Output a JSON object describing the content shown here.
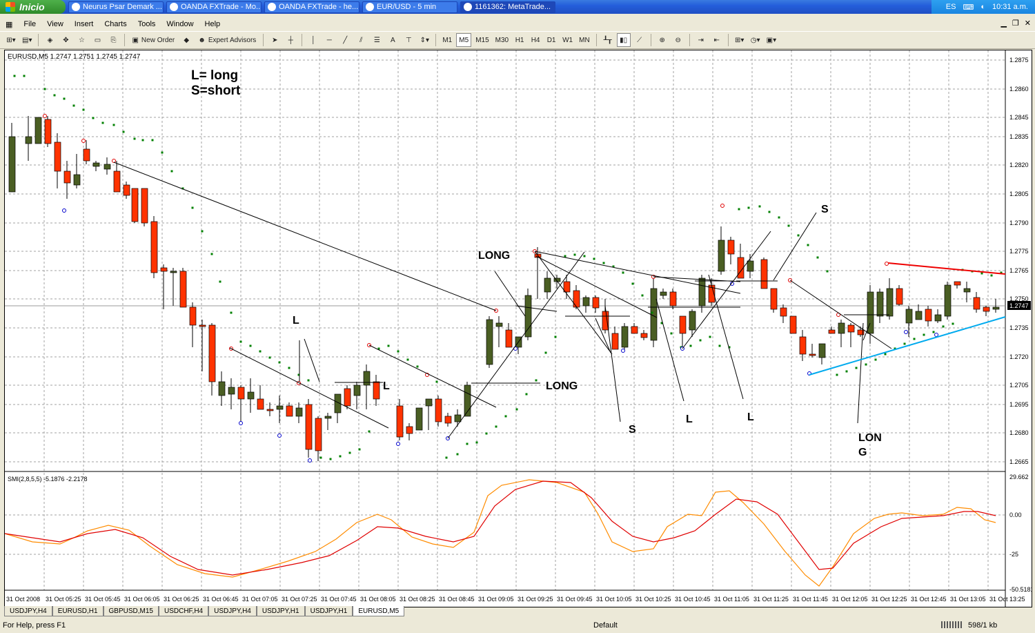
{
  "taskbar": {
    "start_label": "Inicio",
    "tasks": [
      {
        "label": "Neurus Psar Demark ..."
      },
      {
        "label": "OANDA FXTrade - Mo..."
      },
      {
        "label": "OANDA FXTrade - he..."
      },
      {
        "label": "EUR/USD - 5 min"
      },
      {
        "label": "1161362: MetaTrade..."
      }
    ],
    "lang": "ES",
    "clock": "10:31 a.m."
  },
  "menu": [
    "File",
    "View",
    "Insert",
    "Charts",
    "Tools",
    "Window",
    "Help"
  ],
  "toolbar": {
    "new_order": "New Order",
    "expert_advisors": "Expert Advisors",
    "periods": [
      "M1",
      "M5",
      "M15",
      "M30",
      "H1",
      "H4",
      "D1",
      "W1",
      "MN"
    ],
    "text_tool": "A"
  },
  "chart": {
    "header": "EURUSD,M5  1.2747 1.2751 1.2745 1.2747",
    "note_line1": "L= long",
    "note_line2": "S=short",
    "current_price": "1.2747",
    "price_ticks": [
      "1.2875",
      "1.2860",
      "1.2845",
      "1.2835",
      "1.2820",
      "1.2805",
      "1.2790",
      "1.2775",
      "1.2765",
      "1.2750",
      "1.2735",
      "1.2720",
      "1.2705",
      "1.2695",
      "1.2680",
      "1.2665"
    ],
    "time_ticks": [
      "31 Oct 2008",
      "31 Oct 05:25",
      "31 Oct 05:45",
      "31 Oct 06:05",
      "31 Oct 06:25",
      "31 Oct 06:45",
      "31 Oct 07:05",
      "31 Oct 07:25",
      "31 Oct 07:45",
      "31 Oct 08:05",
      "31 Oct 08:25",
      "31 Oct 08:45",
      "31 Oct 09:05",
      "31 Oct 09:25",
      "31 Oct 09:45",
      "31 Oct 10:05",
      "31 Oct 10:25",
      "31 Oct 10:45",
      "31 Oct 11:05",
      "31 Oct 11:25",
      "31 Oct 11:45",
      "31 Oct 12:05",
      "31 Oct 12:25",
      "31 Oct 12:45",
      "31 Oct 13:05",
      "31 Oct 13:25"
    ],
    "annotations": {
      "l1": "L",
      "l2": "L",
      "long1": "LONG",
      "long2": "LONG",
      "s1": "S",
      "l3": "L",
      "l4": "L",
      "s2": "S",
      "long3a": "LON",
      "long3b": "G"
    },
    "indicator_header": "SMI(2,8,5,5) -5.1876 -2.2178",
    "indicator_ticks": [
      "29.662",
      "0.00",
      "-25",
      "-50.5181"
    ],
    "colors": {
      "bull": "#4a5e23",
      "bear": "#ff3300",
      "psar": "#008000",
      "smi_fast": "#ff8c00",
      "smi_slow": "#e00000",
      "trend_up": "#00aaee",
      "trend_dn": "#ee0000"
    }
  },
  "tabs": [
    "USDJPY,H4",
    "EURUSD,H1",
    "GBPUSD,M15",
    "USDCHF,H4",
    "USDJPY,H4",
    "USDJPY,H1",
    "USDJPY,H1",
    "EURUSD,M5"
  ],
  "status": {
    "help": "For Help, press F1",
    "profile": "Default",
    "traffic": "598/1 kb"
  }
}
